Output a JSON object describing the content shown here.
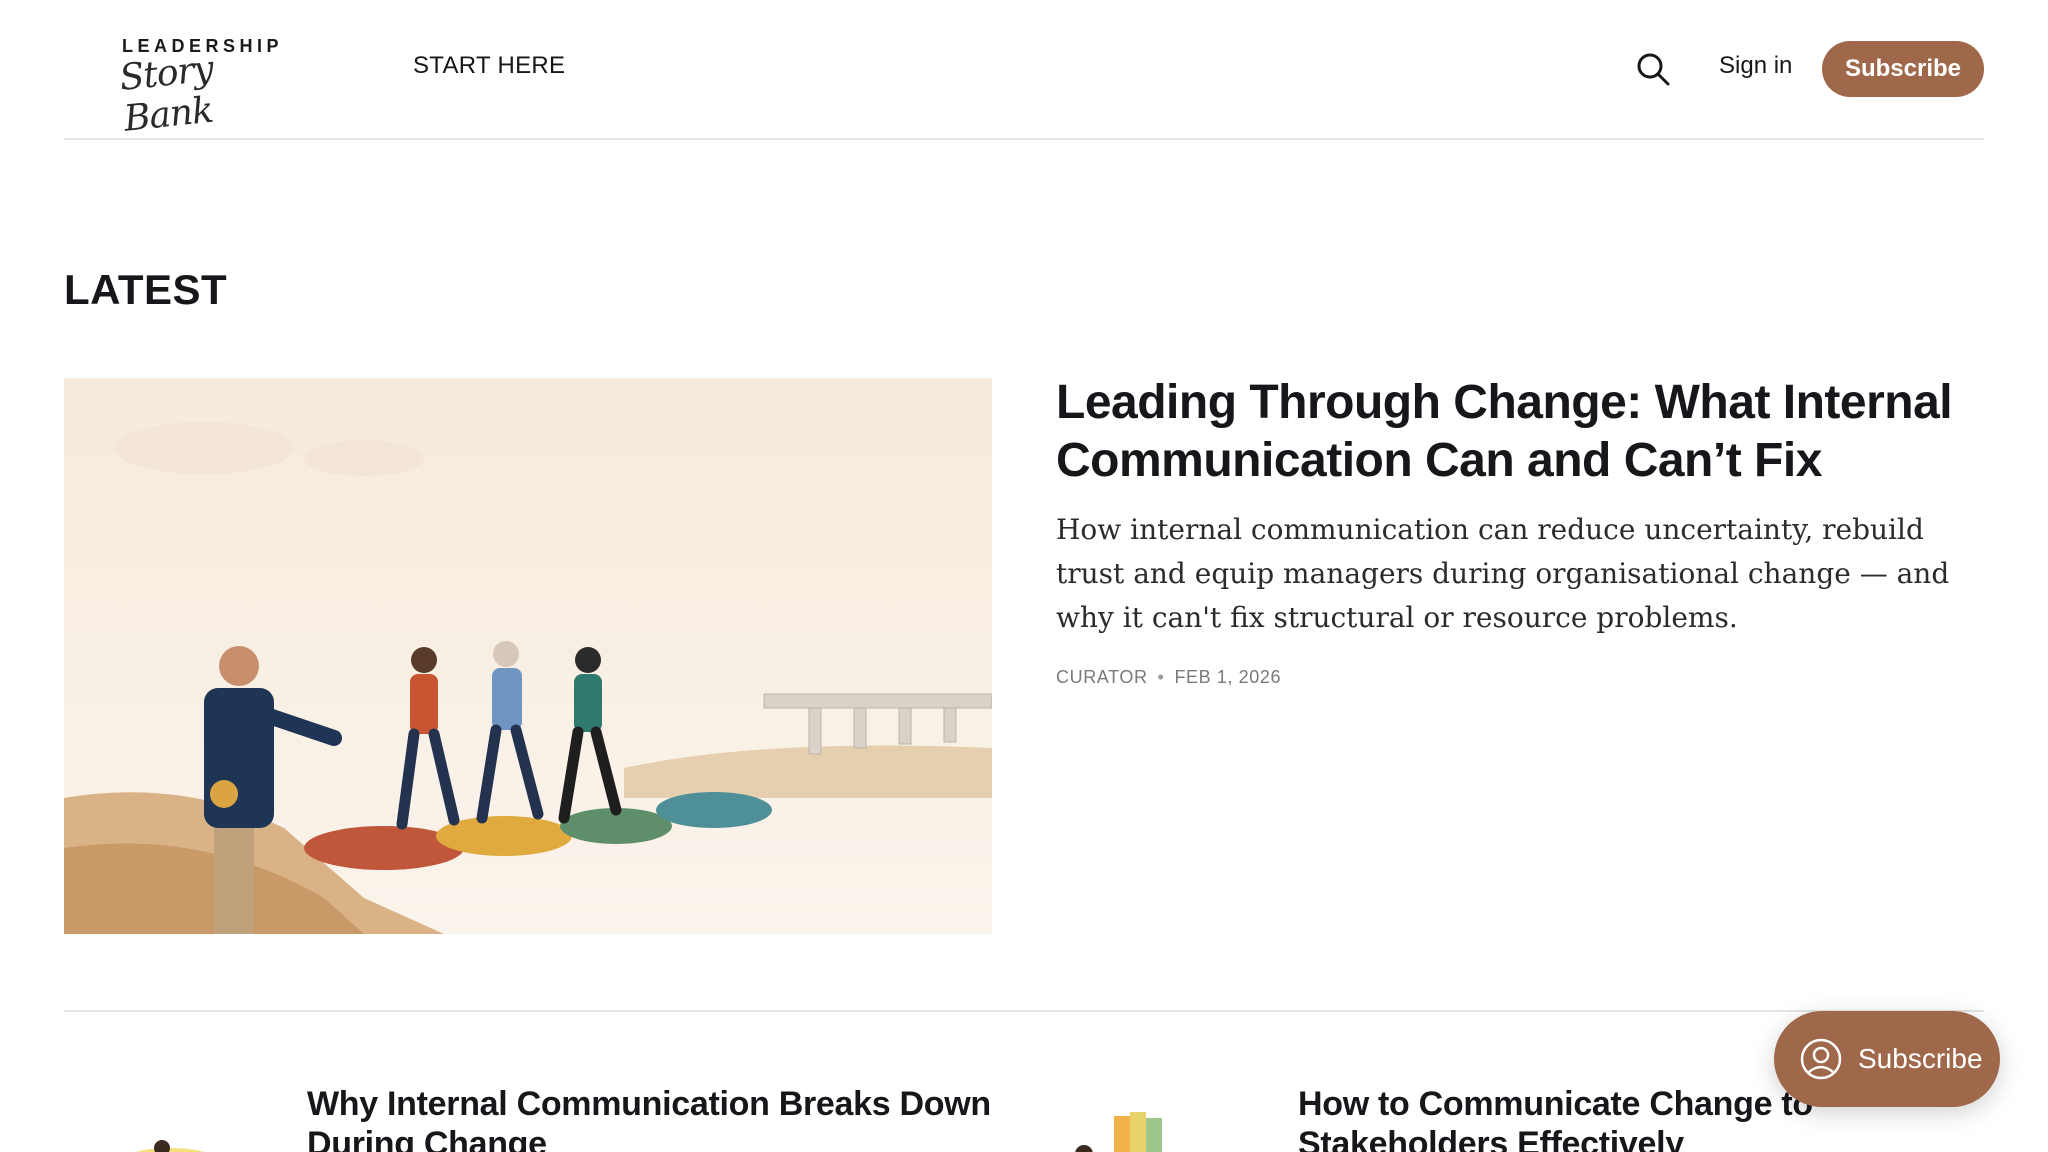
{
  "header": {
    "logo_top": "LEADERSHIP",
    "logo_script": "Story Bank",
    "nav_start": "START HERE",
    "search_icon": "search-icon",
    "signin_label": "Sign in",
    "subscribe_label": "Subscribe"
  },
  "section": {
    "latest_label": "LATEST"
  },
  "featured": {
    "title": "Leading Through Change: What Internal Communication Can and Can’t Fix",
    "excerpt": "How internal communication can reduce uncertainty, rebuild trust and equip managers during organisational change — and why it can't fix structural or resource problems.",
    "author": "CURATOR",
    "date": "FEB 1, 2026"
  },
  "cards": [
    {
      "title": "Why Internal Communication Breaks Down During Change"
    },
    {
      "title": "How to Communicate Change to Stakeholders Effectively"
    }
  ],
  "floating": {
    "label": "Subscribe",
    "icon": "user-icon"
  },
  "colors": {
    "accent": "#a0684a",
    "background": "#ffffff",
    "text": "#15171a"
  }
}
